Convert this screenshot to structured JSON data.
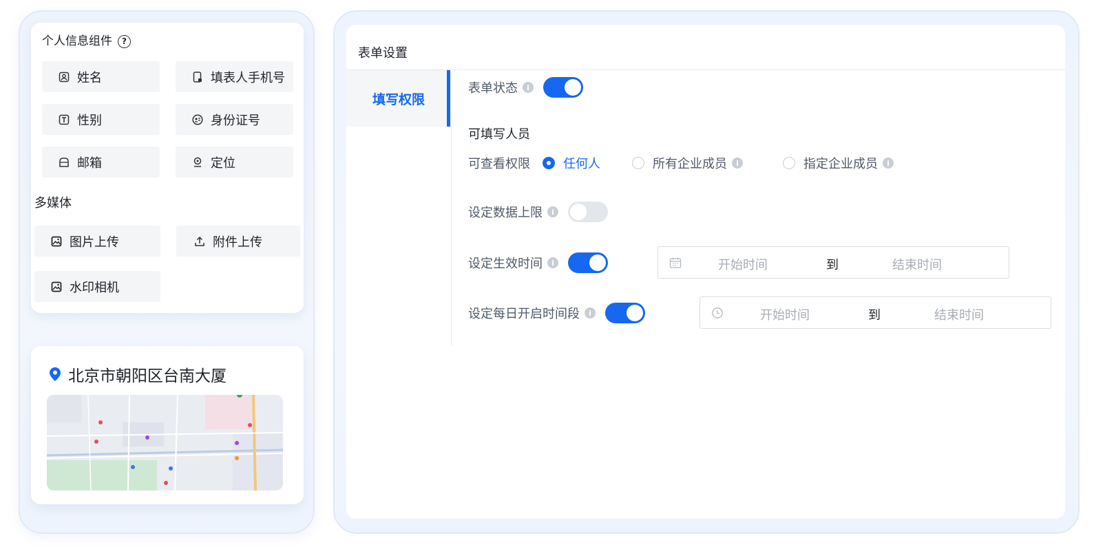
{
  "personal": {
    "title": "个人信息组件",
    "help_glyph": "?",
    "items": [
      {
        "label": "姓名",
        "icon": "user-badge-icon"
      },
      {
        "label": "填表人手机号",
        "icon": "phone-icon"
      },
      {
        "label": "性别",
        "icon": "text-box-icon"
      },
      {
        "label": "身份证号",
        "icon": "id-card-icon"
      },
      {
        "label": "邮箱",
        "icon": "mailbox-icon"
      },
      {
        "label": "定位",
        "icon": "location-pin-icon"
      }
    ]
  },
  "media": {
    "title": "多媒体",
    "items": [
      {
        "label": "图片上传",
        "icon": "image-icon"
      },
      {
        "label": "附件上传",
        "icon": "upload-icon"
      },
      {
        "label": "水印相机",
        "icon": "watermark-camera-icon"
      }
    ]
  },
  "location": {
    "address": "北京市朝阳区台南大厦",
    "icon": "map-pin-icon"
  },
  "settings": {
    "title": "表单设置",
    "tab": "填写权限",
    "form_status": {
      "label": "表单状态",
      "enabled": true
    },
    "fillers_title": "可填写人员",
    "view_permission": {
      "label": "可查看权限",
      "options": [
        {
          "label": "任何人",
          "selected": true
        },
        {
          "label": "所有企业成员",
          "selected": false
        },
        {
          "label": "指定企业成员",
          "selected": false
        }
      ]
    },
    "data_limit": {
      "label": "设定数据上限",
      "enabled": false
    },
    "effective_time": {
      "label": "设定生效时间",
      "enabled": true,
      "start_placeholder": "开始时间",
      "separator": "到",
      "end_placeholder": "结束时间"
    },
    "daily_time": {
      "label": "设定每日开启时间段",
      "enabled": true,
      "start_placeholder": "开始时间",
      "separator": "到",
      "end_placeholder": "结束时间"
    }
  },
  "colors": {
    "accent": "#1668f0",
    "info_icon": "#c9cdd4",
    "toggle_off": "#e3e6eb"
  }
}
